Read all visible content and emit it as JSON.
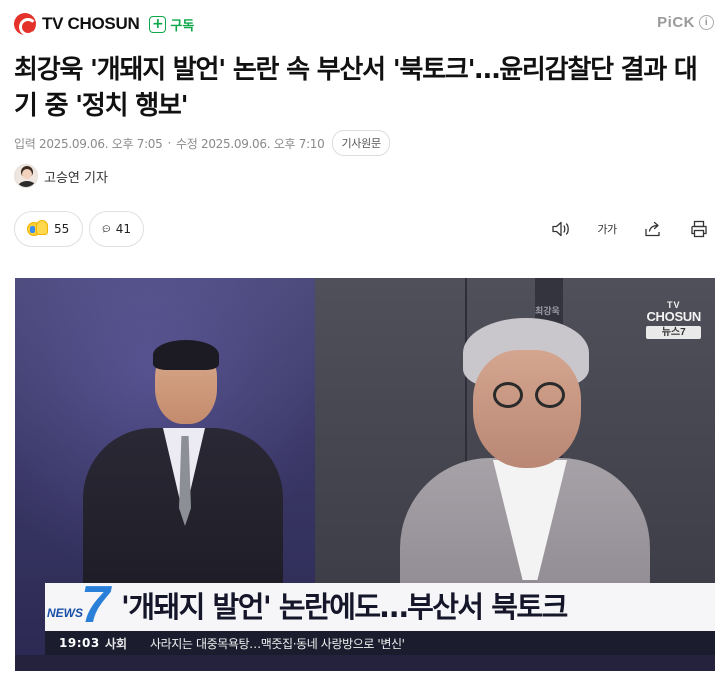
{
  "header": {
    "brand_name": "TV CHOSUN",
    "subscribe_label": "구독",
    "pick_label": "PiCK",
    "pick_help": "i"
  },
  "article": {
    "title": "최강욱 '개돼지 발언' 논란 속 부산서 '북토크'…윤리감찰단 결과 대기 중 '정치 행보'",
    "published_label": "입력",
    "published": "2025.09.06. 오후 7:05",
    "updated_label": "수정",
    "updated": "2025.09.06. 오후 7:10",
    "origin_button": "기사원문",
    "reporter": "고승연 기자"
  },
  "actions": {
    "reaction_count": "55",
    "comment_count": "41",
    "font_size_label": "가가"
  },
  "video": {
    "watermark_line1": "TV",
    "watermark_line2": "CHOSUN",
    "watermark_line3": "뉴스7",
    "wall_sign": "최강욱",
    "program_logo_text": "NEWS",
    "program_logo_number": "7",
    "caption_headline": "'개돼지 발언' 논란에도…부산서 북토크",
    "time": "19:03",
    "category": "사회",
    "crawl": "사라지는 대중목욕탕…맥줏집·동네 사랑방으로 '변신'"
  },
  "colors": {
    "brand_red": "#e4322b",
    "subscribe_green": "#0ea84a",
    "news7_blue": "#2a80d8"
  }
}
